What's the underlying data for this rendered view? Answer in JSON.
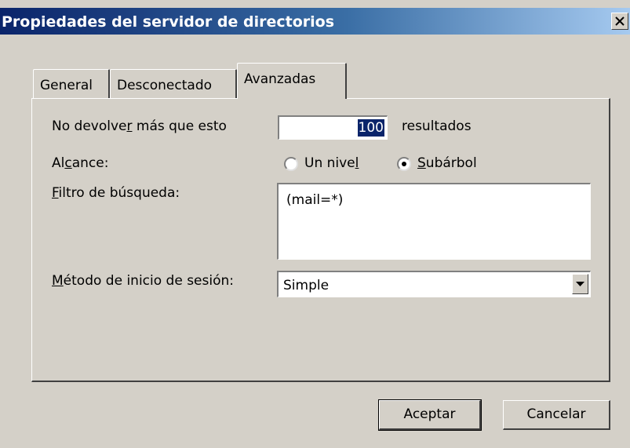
{
  "window": {
    "title": "Propiedades del servidor de directorios",
    "close_icon": "close-icon"
  },
  "tabs": [
    {
      "label": "General",
      "active": false
    },
    {
      "label": "Desconectado",
      "active": false
    },
    {
      "label": "Avanzadas",
      "active": true
    }
  ],
  "max_results": {
    "label_pre": "No devolve",
    "label_accel": "r",
    "label_post": " más que esto",
    "value": "100",
    "suffix": "resultados"
  },
  "scope": {
    "label_pre": "Al",
    "label_accel": "c",
    "label_post": "ance:",
    "options": [
      {
        "pre": "Un nive",
        "accel": "l",
        "post": "",
        "selected": false
      },
      {
        "pre": "",
        "accel": "S",
        "post": "ubárbol",
        "selected": true
      }
    ]
  },
  "search_filter": {
    "label_accel": "F",
    "label_post": "iltro de búsqueda:",
    "value": "(mail=*)"
  },
  "login_method": {
    "label_accel": "M",
    "label_post": "étodo de inicio de sesión:",
    "selected": "Simple",
    "arrow_icon": "dropdown-arrow-icon"
  },
  "buttons": {
    "ok": "Aceptar",
    "cancel": "Cancelar"
  }
}
